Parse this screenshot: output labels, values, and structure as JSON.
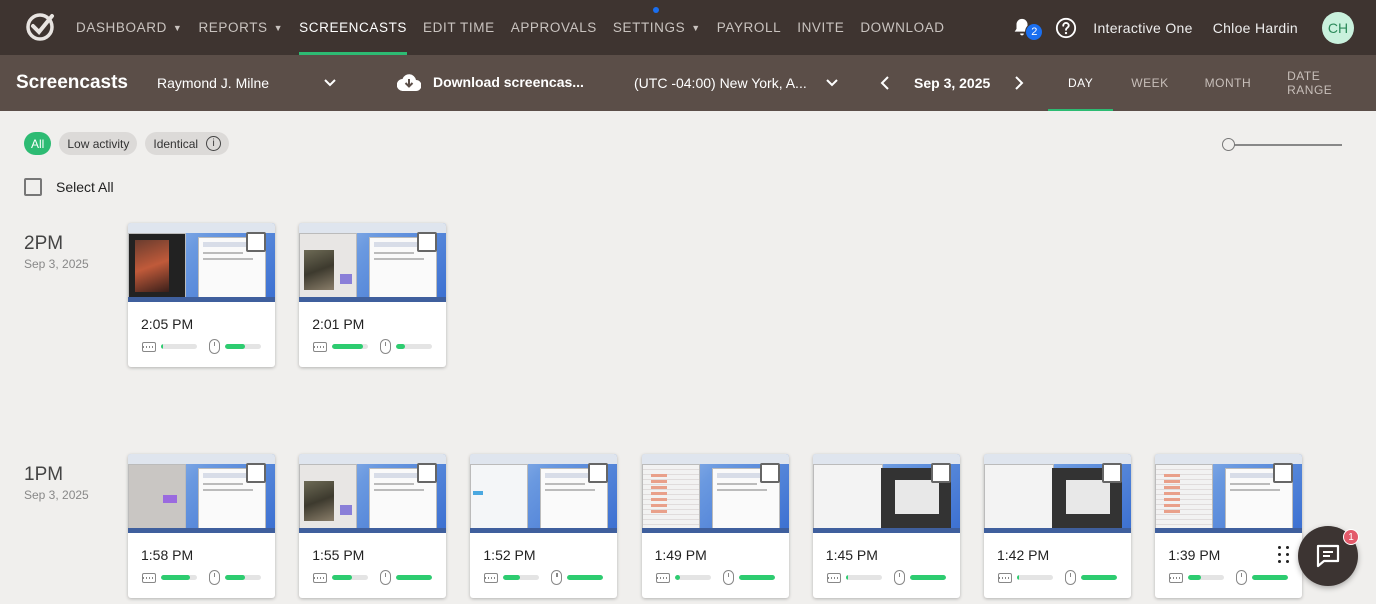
{
  "nav": {
    "items": [
      {
        "label": "DASHBOARD",
        "caret": true,
        "active": false
      },
      {
        "label": "REPORTS",
        "caret": true,
        "active": false
      },
      {
        "label": "SCREENCASTS",
        "caret": false,
        "active": true
      },
      {
        "label": "EDIT TIME",
        "caret": false,
        "active": false
      },
      {
        "label": "APPROVALS",
        "caret": false,
        "active": false
      },
      {
        "label": "SETTINGS",
        "caret": true,
        "active": false
      },
      {
        "label": "PAYROLL",
        "caret": false,
        "active": false
      },
      {
        "label": "INVITE",
        "caret": false,
        "active": false
      },
      {
        "label": "DOWNLOAD",
        "caret": false,
        "active": false
      }
    ],
    "notification_count": "2",
    "org_name": "Interactive One",
    "user_name": "Chloe Hardin",
    "avatar_initials": "CH"
  },
  "subbar": {
    "title": "Screencasts",
    "member": "Raymond J. Milne",
    "download_label": "Download screencas...",
    "timezone": "(UTC -04:00) New York, A...",
    "date": "Sep 3, 2025",
    "period_tabs": [
      "DAY",
      "WEEK",
      "MONTH",
      "DATE RANGE"
    ],
    "active_period": "DAY"
  },
  "filters": {
    "chips": [
      "All",
      "Low activity",
      "Identical"
    ],
    "active_chip": "All",
    "select_all_label": "Select All"
  },
  "groups": [
    {
      "hour": "2PM",
      "date": "Sep 3, 2025",
      "shots": [
        {
          "time": "2:05 PM",
          "keyboard": 0.05,
          "mouse": 0.55,
          "variant": "media"
        },
        {
          "time": "2:01 PM",
          "keyboard": 0.85,
          "mouse": 0.25,
          "variant": "media2"
        }
      ]
    },
    {
      "hour": "1PM",
      "date": "Sep 3, 2025",
      "shots": [
        {
          "time": "1:58 PM",
          "keyboard": 0.8,
          "mouse": 0.55,
          "variant": "gray"
        },
        {
          "time": "1:55 PM",
          "keyboard": 0.55,
          "mouse": 1.0,
          "variant": "media2"
        },
        {
          "time": "1:52 PM",
          "keyboard": 0.45,
          "mouse": 1.0,
          "variant": "light"
        },
        {
          "time": "1:49 PM",
          "keyboard": 0.15,
          "mouse": 1.0,
          "variant": "table"
        },
        {
          "time": "1:45 PM",
          "keyboard": 0.05,
          "mouse": 1.0,
          "variant": "dark"
        },
        {
          "time": "1:42 PM",
          "keyboard": 0.05,
          "mouse": 1.0,
          "variant": "dark"
        },
        {
          "time": "1:39 PM",
          "keyboard": 0.35,
          "mouse": 1.0,
          "variant": "table"
        }
      ]
    }
  ],
  "chat_badge": "1",
  "colors": {
    "topnav": "#3e3430",
    "subbar": "#5b4e48",
    "accent": "#2dbb73",
    "badge": "#1a6ff0"
  }
}
